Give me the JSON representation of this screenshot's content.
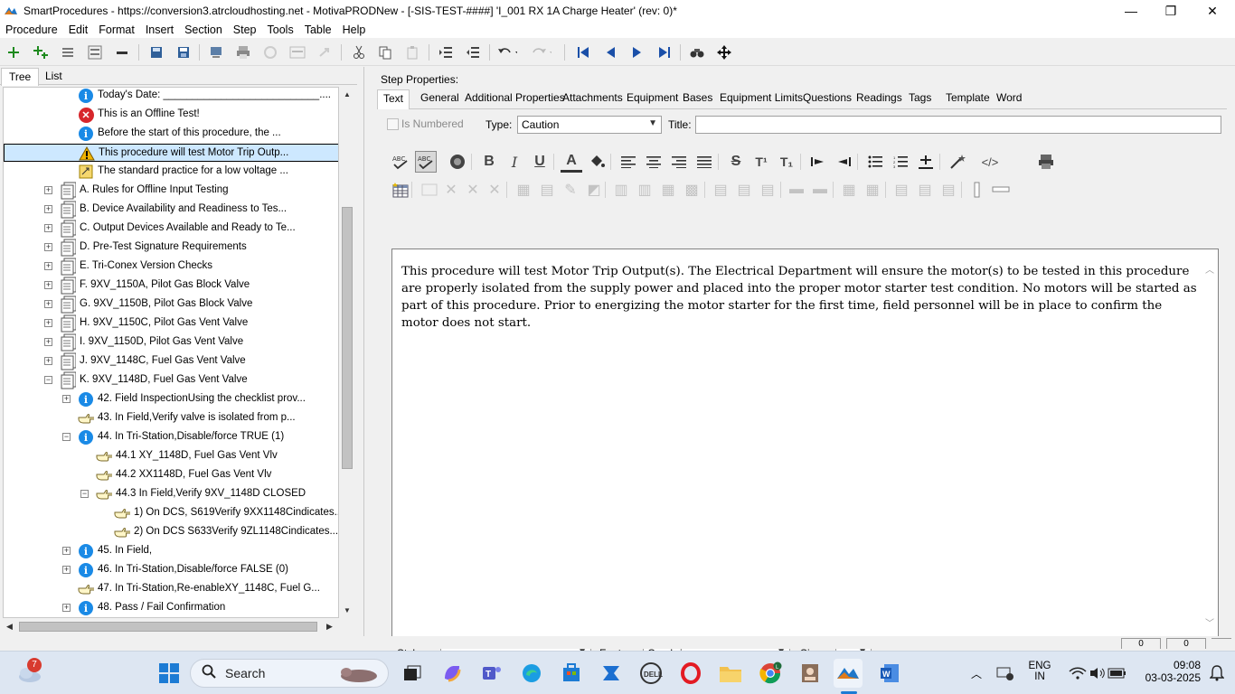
{
  "window": {
    "title": "SmartProcedures - https://conversion3.atrcloudhosting.net - MotivaPRODNew - [-SIS-TEST-####] 'I_001 RX 1A Charge Heater' (rev: 0)*",
    "minimize": "—",
    "maximize": "❐",
    "close": "✕"
  },
  "menu": [
    "Procedure",
    "Edit",
    "Format",
    "Insert",
    "Section",
    "Step",
    "Tools",
    "Table",
    "Help"
  ],
  "left_tabs": [
    "Tree",
    "List"
  ],
  "tree": [
    {
      "label": "Today's Date: ___________________________....",
      "icon": "info-icon",
      "expander": ""
    },
    {
      "label": "This is an Offline Test!",
      "icon": "error-icon",
      "expander": ""
    },
    {
      "label": "Before the start of this procedure, the ...",
      "icon": "info-icon",
      "expander": ""
    },
    {
      "label": "This procedure will test Motor Trip Outp...",
      "icon": "warning-icon",
      "expander": ""
    },
    {
      "label": "The standard practice for a low voltage ...",
      "icon": "note-icon",
      "expander": ""
    },
    {
      "label": "A. Rules for Offline Input Testing",
      "icon": "section-icon",
      "expander": "+"
    },
    {
      "label": "B. Device Availability and Readiness to Tes...",
      "icon": "section-icon",
      "expander": "+"
    },
    {
      "label": "C. Output Devices Available and Ready to Te...",
      "icon": "section-icon",
      "expander": "+"
    },
    {
      "label": "D. Pre-Test Signature Requirements",
      "icon": "section-icon",
      "expander": "+"
    },
    {
      "label": "E. Tri-Conex Version Checks",
      "icon": "section-icon",
      "expander": "+"
    },
    {
      "label": "F. 9XV_1150A, Pilot Gas Block Valve",
      "icon": "section-icon",
      "expander": "+"
    },
    {
      "label": "G. 9XV_1150B, Pilot Gas Block Valve",
      "icon": "section-icon",
      "expander": "+"
    },
    {
      "label": "H. 9XV_1150C, Pilot Gas Vent Valve",
      "icon": "section-icon",
      "expander": "+"
    },
    {
      "label": "I. 9XV_1150D, Pilot Gas Vent Valve",
      "icon": "section-icon",
      "expander": "+"
    },
    {
      "label": "J. 9XV_1148C, Fuel Gas Vent Valve",
      "icon": "section-icon",
      "expander": "+"
    },
    {
      "label": "K. 9XV_1148D, Fuel Gas Vent Valve",
      "icon": "section-icon",
      "expander": "−"
    },
    {
      "label": "42. Field InspectionUsing the checklist prov...",
      "icon": "info-icon",
      "expander": "+"
    },
    {
      "label": "43. In Field,Verify valve is isolated from p...",
      "icon": "hand-pointer-icon",
      "expander": ""
    },
    {
      "label": "44. In Tri-Station,Disable/force TRUE (1)",
      "icon": "info-icon",
      "expander": "−"
    },
    {
      "label": "44.1 XY_1148D, Fuel Gas Vent Vlv",
      "icon": "hand-pointer-icon",
      "expander": ""
    },
    {
      "label": "44.2 XX1148D, Fuel Gas Vent Vlv",
      "icon": "hand-pointer-icon",
      "expander": ""
    },
    {
      "label": "44.3 In Field,Verify 9XV_1148D CLOSED",
      "icon": "hand-pointer-icon",
      "expander": "−"
    },
    {
      "label": "1) On DCS,  S619Verify  9XX1148Cindicates...",
      "icon": "hand-pointer-icon",
      "expander": ""
    },
    {
      "label": "2) On DCS  S633Verify  9ZL1148Cindicates...",
      "icon": "hand-pointer-icon",
      "expander": ""
    },
    {
      "label": "45. In Field,",
      "icon": "info-icon",
      "expander": "+"
    },
    {
      "label": "46. In Tri-Station,Disable/force FALSE (0)",
      "icon": "info-icon",
      "expander": "+"
    },
    {
      "label": "47. In Tri-Station,Re-enableXY_1148C, Fuel G...",
      "icon": "hand-pointer-icon",
      "expander": ""
    },
    {
      "label": "48. Pass / Fail Confirmation",
      "icon": "info-icon",
      "expander": "+"
    }
  ],
  "step_properties": {
    "header": "Step Properties:",
    "tabs": [
      "Text",
      "General",
      "Additional Properties",
      "Attachments",
      "Equipment",
      "Bases",
      "Equipment Limits",
      "Questions",
      "Readings",
      "Tags",
      "Template",
      "Word"
    ],
    "is_numbered_label": "Is Numbered",
    "type_label": "Type:",
    "type_value": "Caution",
    "title_label": "Title:",
    "title_value": "",
    "body_text": "This procedure will test Motor Trip Output(s).  The Electrical Department will ensure the motor(s) to be tested in this procedure are properly isolated from the supply power and placed into the proper motor starter test condition. No motors will be started as part of this procedure.  Prior to energizing the motor starter for the first time, field personnel will be in place to confirm the motor does not start.",
    "style_label": "Style:",
    "style_value": "",
    "font_label": "Font:",
    "font_value": "Cambria",
    "size_label": "Size:",
    "size_value": ""
  },
  "format_buttons": {
    "bold": "B",
    "italic": "I",
    "underline": "U",
    "font_color": "A",
    "strike": "S",
    "superscript": "T¹",
    "subscript": "T₁"
  },
  "taskbar": {
    "search_placeholder": "Search",
    "weather_badge": "7",
    "language": "ENG",
    "region": "IN",
    "time": "09:08",
    "date": "03-03-2025"
  },
  "status": {
    "left_value": "0",
    "right_value": "0"
  },
  "colors": {
    "selected_row": "#cde8ff",
    "info_blue": "#1a8ae6",
    "error_red": "#d7262b",
    "taskbar": "#dde6f2"
  }
}
